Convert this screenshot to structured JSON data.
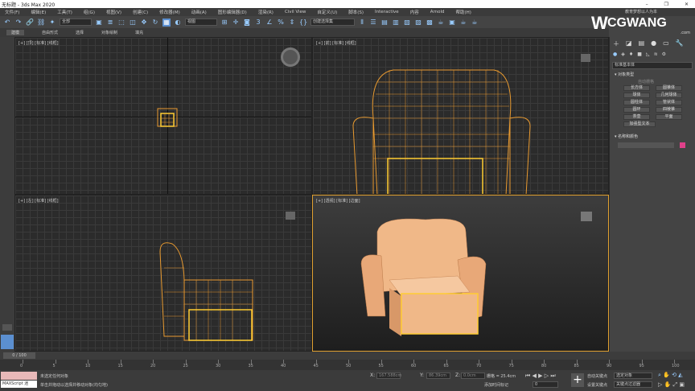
{
  "window": {
    "title": "无标题 - 3ds Max 2020",
    "minimize": "–",
    "maximize": "❐",
    "close": "✕"
  },
  "menu": [
    "文件(F)",
    "编辑(E)",
    "工具(T)",
    "组(G)",
    "视图(V)",
    "创建(C)",
    "修改器(M)",
    "动画(A)",
    "图形编辑器(D)",
    "渲染(R)",
    "Civil View",
    "自定义(U)",
    "脚本(S)",
    "Interactive",
    "内容",
    "Arnold",
    "帮助(H)"
  ],
  "toolbar": {
    "filter": "全部",
    "coord": "视图",
    "selection_set": "创建选择集"
  },
  "ribbon": [
    "建模",
    "自由形式",
    "选择",
    "对象绘制",
    "填充"
  ],
  "watermark": {
    "brand": "CGWANG",
    "sub": ".com",
    "slogan": "教育梦想以人为本"
  },
  "viewports": [
    {
      "label": "[+] [顶] [标准] [线框]"
    },
    {
      "label": "[+] [前] [标准] [线框]"
    },
    {
      "label": "[+] [左] [标准] [线框]"
    },
    {
      "label": "[+] [透视] [标准] [边面]"
    }
  ],
  "command_panel": {
    "dropdown": "标准基本体",
    "section_object_type": "对象类型",
    "autogrid": "自动栅格",
    "buttons": [
      "长方体",
      "圆锥体",
      "球体",
      "几何球体",
      "圆柱体",
      "管状体",
      "圆环",
      "四棱锥",
      "茶壶",
      "平面",
      "加强型文本"
    ],
    "section_name_color": "名称和颜色",
    "object_color": "#e0408a"
  },
  "timeline": {
    "frame": "0 / 100",
    "ticks": [
      "0",
      "5",
      "10",
      "15",
      "20",
      "25",
      "30",
      "35",
      "40",
      "45",
      "50",
      "55",
      "60",
      "65",
      "70",
      "75",
      "80",
      "85",
      "90",
      "95",
      "100"
    ]
  },
  "status": {
    "script_label": "MAXScript 迷",
    "line1": "未选定任何对象",
    "line2": "单击并拖动以选择并移动对象(均匀地)",
    "x_label": "X:",
    "x": "167.588cm",
    "y_label": "Y:",
    "y": "86.39cm",
    "z_label": "Z:",
    "z": "0.0cm",
    "grid": "栅格 = 25.4cm",
    "add_time_tag": "添加时间标记",
    "auto_key": "自动关键点",
    "set_key": "设置关键点",
    "selected_object": "选定对象",
    "key_filter": "关键点过滤器",
    "frame_value": "0"
  }
}
